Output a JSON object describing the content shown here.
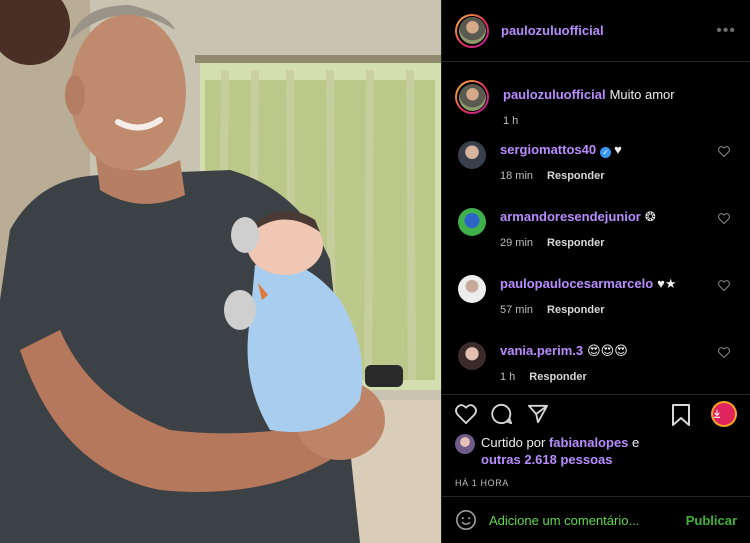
{
  "header": {
    "username": "paulozuluofficial",
    "more_label": "•••"
  },
  "caption": {
    "username": "paulozuluofficial",
    "text": "Muito amor",
    "time": "1 h"
  },
  "comments": [
    {
      "username": "sergiomattos40",
      "text": "♥",
      "time": "18 min",
      "reply": "Responder",
      "verified": true
    },
    {
      "username": "armandoresendejunior",
      "text": "❂",
      "time": "29 min",
      "reply": "Responder",
      "verified": false
    },
    {
      "username": "paulopaulocesarmarcelo",
      "text": "♥★",
      "time": "57 min",
      "reply": "Responder",
      "verified": false
    },
    {
      "username": "vania.perim.3",
      "text": "😍😍😍",
      "time": "1 h",
      "reply": "Responder",
      "verified": false
    }
  ],
  "likes": {
    "prefix": "Curtido por",
    "user": "fabianalopes",
    "conj": "e",
    "others": "outras 2.618 pessoas"
  },
  "posted_ago": "HÁ 1 HORA",
  "add_comment": {
    "placeholder": "Adicione um comentário...",
    "post_label": "Publicar"
  },
  "colors": {
    "username": "#b98cff",
    "placeholder": "#60d84a",
    "accent_download": "#e0245e"
  }
}
